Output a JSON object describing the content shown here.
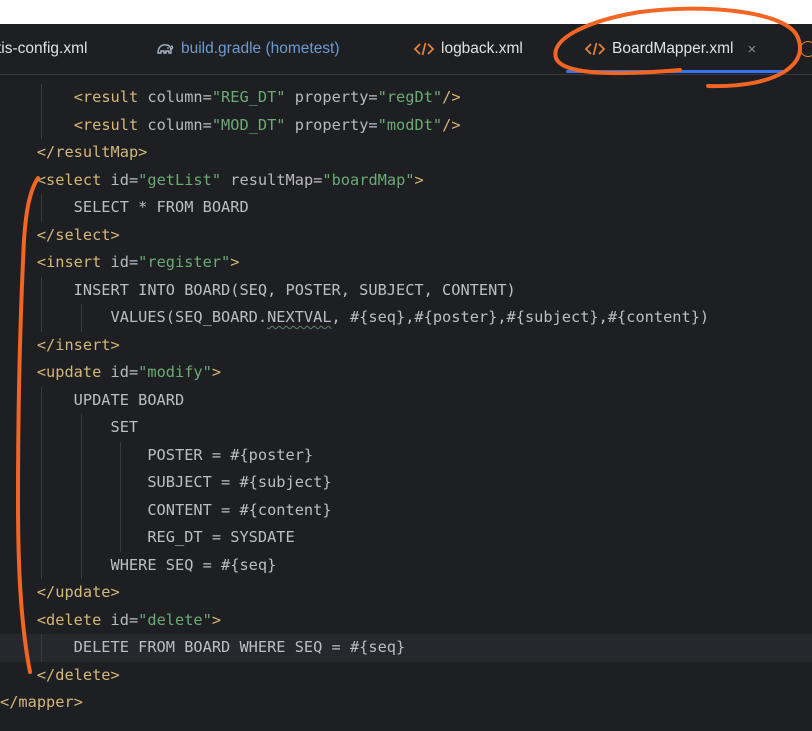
{
  "tabs": [
    {
      "label": "tis-config.xml"
    },
    {
      "label": "build.gradle (hometest)"
    },
    {
      "label": "logback.xml"
    },
    {
      "label": "BoardMapper.xml",
      "active": true
    }
  ],
  "tab_close_glyph": "×",
  "code_lines": [
    "        <result column=\"REG_DT\" property=\"regDt\"/>",
    "        <result column=\"MOD_DT\" property=\"modDt\"/>",
    "    </resultMap>",
    "    <select id=\"getList\" resultMap=\"boardMap\">",
    "        SELECT * FROM BOARD",
    "    </select>",
    "    <insert id=\"register\">",
    "        INSERT INTO BOARD(SEQ, POSTER, SUBJECT, CONTENT)",
    "            VALUES(SEQ_BOARD.NEXTVAL, #{seq},#{poster},#{subject},#{content})",
    "    </insert>",
    "    <update id=\"modify\">",
    "        UPDATE BOARD",
    "            SET",
    "                POSTER = #{poster}",
    "                SUBJECT = #{subject}",
    "                CONTENT = #{content}",
    "                REG_DT = SYSDATE",
    "            WHERE SEQ = #{seq}",
    "    </update>",
    "    <delete id=\"delete\">",
    "        DELETE FROM BOARD WHERE SEQ = #{seq}",
    "    </delete>",
    "</mapper>"
  ],
  "current_line": 20,
  "colors": {
    "background": "#1e1f22",
    "tag": "#d5b778",
    "string": "#6aab73",
    "text": "#bcbec4",
    "annotation": "#f26522",
    "tab_underline": "#3574f0"
  },
  "icons": {
    "build_tab": "gradle-elephant-icon",
    "xml_tab": "xml-code-icon"
  }
}
